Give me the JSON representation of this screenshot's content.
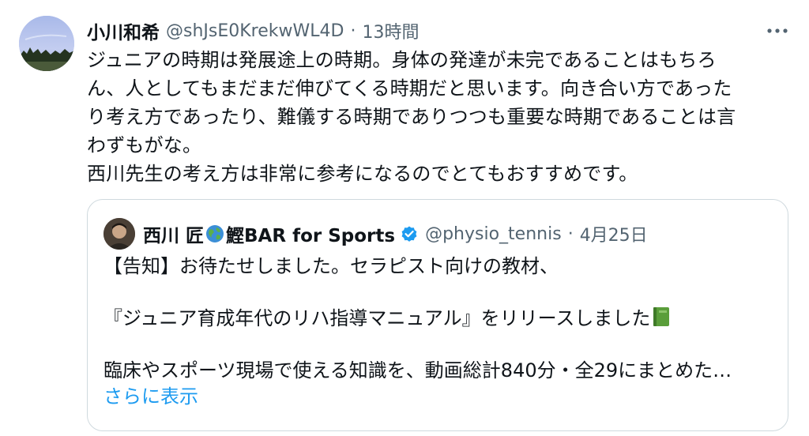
{
  "tweet": {
    "author_name": "小川和希",
    "handle": "@shJsE0KrekwWL4D",
    "separator": "·",
    "time": "13時間",
    "text": "ジュニアの時期は発展途上の時期。身体の発達が未完であることはもちろ\nん、人としてもまだまだ伸びてくる時期だと思います。向き合い方であった\nり考え方であったり、難儀する時期でありつつも重要な時期であることは言\nわずもがな。\n西川先生の考え方は非常に参考になるのでとてもおすすめです。",
    "more_icon": "more-horizontal-icon"
  },
  "quote": {
    "name_part1": "西川 匠",
    "name_emoji": "globe-icon",
    "name_part2": "鰹BAR for Sports",
    "verified_icon": "verified-badge-icon",
    "handle": "@physio_tennis",
    "separator": "·",
    "date": "4月25日",
    "line1": "【告知】お待たせしました。セラピスト向けの教材、",
    "line2": "『ジュニア育成年代のリハ指導マニュアル』をリリースしました",
    "line2_emoji": "green-book-icon",
    "line3": "臨床やスポーツ現場で使える知識を、動画総計840分・全29にまとめた…",
    "show_more": "さらに表示"
  },
  "colors": {
    "text": "#0f1419",
    "secondary": "#536471",
    "link": "#1d9bf0",
    "border": "#cfd9de",
    "verified": "#1d9bf0"
  }
}
